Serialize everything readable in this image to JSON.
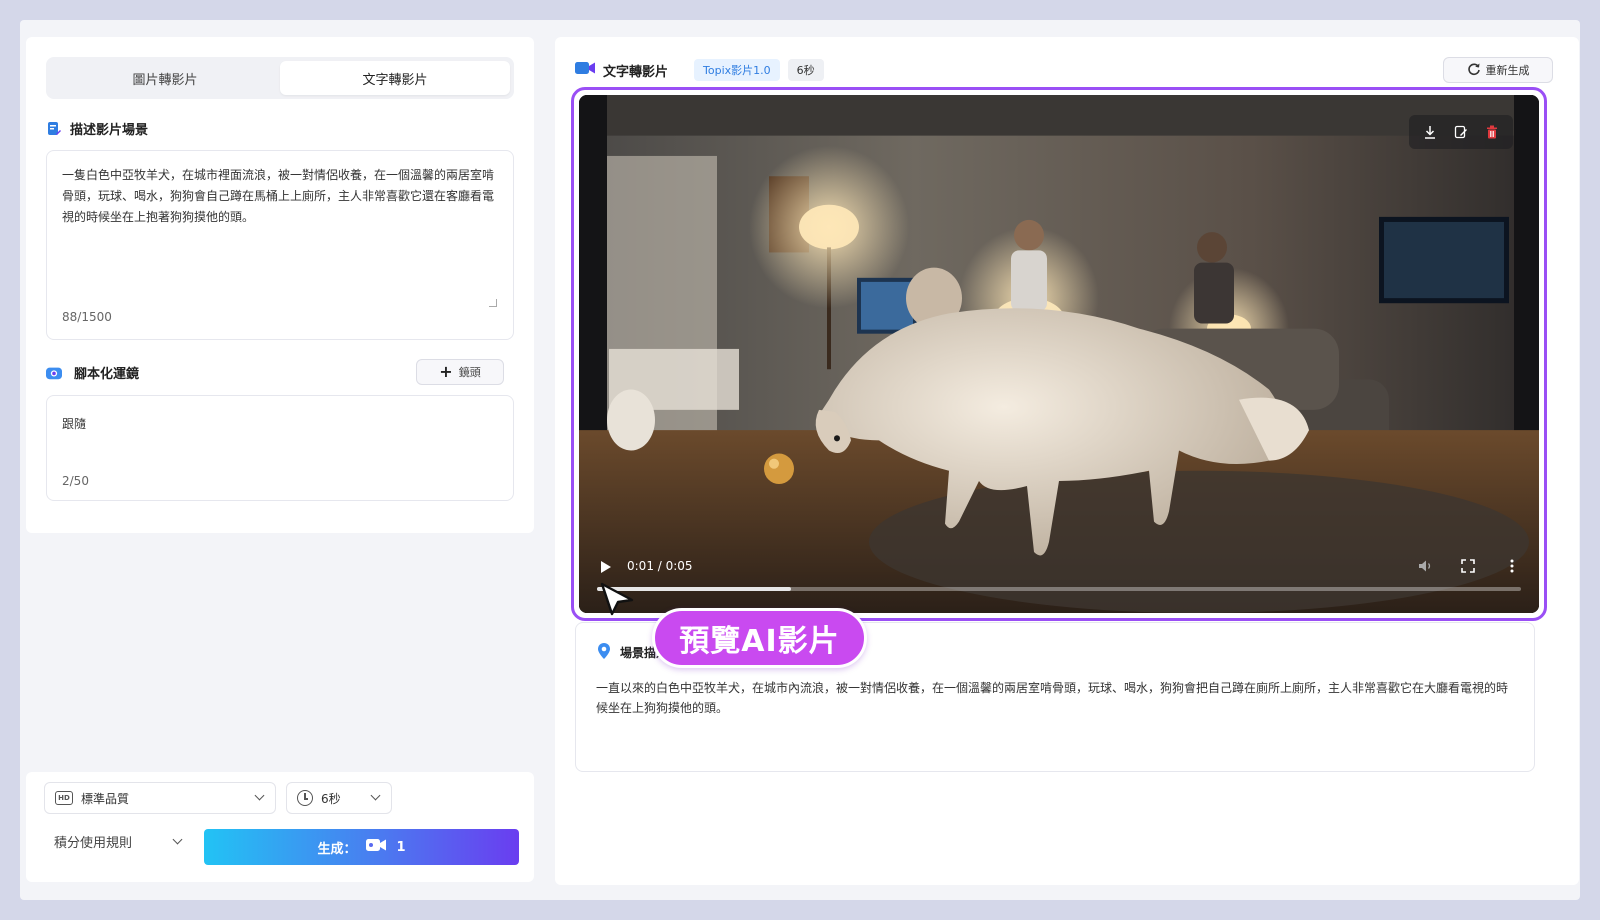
{
  "left": {
    "tabs": [
      {
        "label": "圖片轉影片",
        "active": false
      },
      {
        "label": "文字轉影片",
        "active": true
      }
    ],
    "scene_section": {
      "title": "描述影片場景",
      "text": "一隻白色中亞牧羊犬，在城市裡面流浪，被一對情侶收養，在一個溫馨的兩居室啃骨頭，玩球、喝水，狗狗會自己蹲在馬桶上上廁所，主人非常喜歡它還在客廳看電視的時候坐在上抱著狗狗摸他的頭。",
      "count": "88/1500"
    },
    "shot_section": {
      "title": "腳本化運鏡",
      "add_label": "鏡頭",
      "text": "跟隨",
      "count": "2/50"
    }
  },
  "bottom": {
    "quality": "標準品質",
    "duration": "6秒",
    "rules": "積分使用規則",
    "generate_label": "生成：",
    "generate_count": "1"
  },
  "right": {
    "title": "文字轉影片",
    "model_badge": "Topix影片1.0",
    "duration_badge": "6秒",
    "regen_label": "重新生成",
    "video": {
      "time": "0:01 / 0:05",
      "progress": 0.21
    },
    "description": {
      "title": "場景描述",
      "text": "一直以來的白色中亞牧羊犬，在城市內流浪，被一對情侶收養，在一個溫馨的兩居室啃骨頭，玩球、喝水，狗狗會把自己蹲在廁所上廁所，主人非常喜歡它在大廳看電視的時候坐在上狗狗摸他的頭。"
    }
  },
  "callout": "預覽AI影片",
  "colors": {
    "accent_purple": "#9a4ff5",
    "callout": "#c94af0",
    "button_start": "#22c3f4",
    "button_end": "#6a3df0",
    "model_badge": "#2f7de1",
    "delete_icon": "#e0393e"
  }
}
